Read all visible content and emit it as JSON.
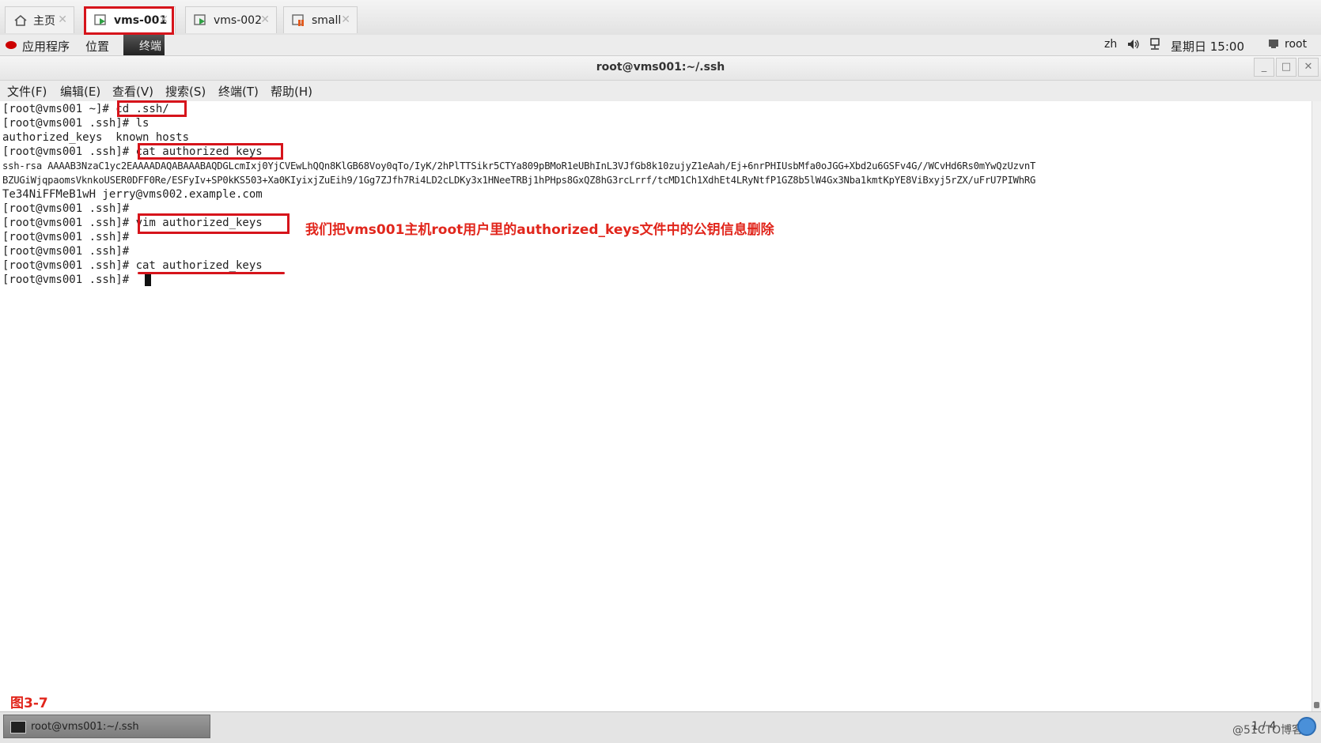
{
  "tabs": [
    {
      "label": "主页",
      "icon": "home-icon"
    },
    {
      "label": "vms-001",
      "icon": "vm-running-icon"
    },
    {
      "label": "vms-002",
      "icon": "vm-running-icon"
    },
    {
      "label": "small",
      "icon": "vm-icon"
    }
  ],
  "tab_close": "✕",
  "panel": {
    "apps": "应用程序",
    "places": "位置",
    "terminal": "终端",
    "lang": "zh",
    "clock": "星期日 15:00",
    "user": "root"
  },
  "window": {
    "title": "root@vms001:~/.ssh"
  },
  "menu": {
    "file": "文件(F)",
    "edit": "编辑(E)",
    "view": "查看(V)",
    "search": "搜索(S)",
    "terminal": "终端(T)",
    "help": "帮助(H)"
  },
  "terminal": {
    "lines": [
      "[root@vms001 ~]# cd .ssh/",
      "[root@vms001 .ssh]# ls",
      "authorized_keys  known_hosts",
      "[root@vms001 .ssh]# cat authorized_keys",
      "ssh-rsa AAAAB3NzaC1yc2EAAAADAQABAAABAQDGLcmIxj0YjCVEwLhQQn8KlGB68Voy0qTo/IyK/2hPlTTSikr5CTYa809pBMoR1eUBhInL3VJfGb8k10zujyZ1eAah/Ej+6nrPHIUsbMfa0oJGG+Xbd2u6GSFv4G//WCvHd6Rs0mYwQzUzvnT",
      "BZUGiWjqpaomsVknkoUSER0DFF0Re/ESFyIv+SP0kKS503+Xa0KIyixjZuEih9/1Gg7ZJfh7Ri4LD2cLDKy3x1HNeeTRBj1hPHps8GxQZ8hG3rcLrrf/tcMD1Ch1XdhEt4LRyNtfP1GZ8b5lW4Gx3Nba1kmtKpYE8ViBxyj5rZX/uFrU7PIWhRG",
      "Te34NiFFMeB1wH jerry@vms002.example.com",
      "[root@vms001 .ssh]#",
      "[root@vms001 .ssh]# vim authorized_keys",
      "[root@vms001 .ssh]#",
      "[root@vms001 .ssh]#",
      "[root@vms001 .ssh]# cat authorized_keys",
      "[root@vms001 .ssh]# "
    ]
  },
  "annotation": "我们把vms001主机root用户里的authorized_keys文件中的公钥信息删除",
  "figure_label": "图3-7",
  "taskbar": {
    "item": "root@vms001:~/.ssh",
    "pager": "1 / 4",
    "watermark": "@51CTO博客"
  },
  "colors": {
    "highlight": "#d6141b",
    "annotation": "#e1261c"
  }
}
